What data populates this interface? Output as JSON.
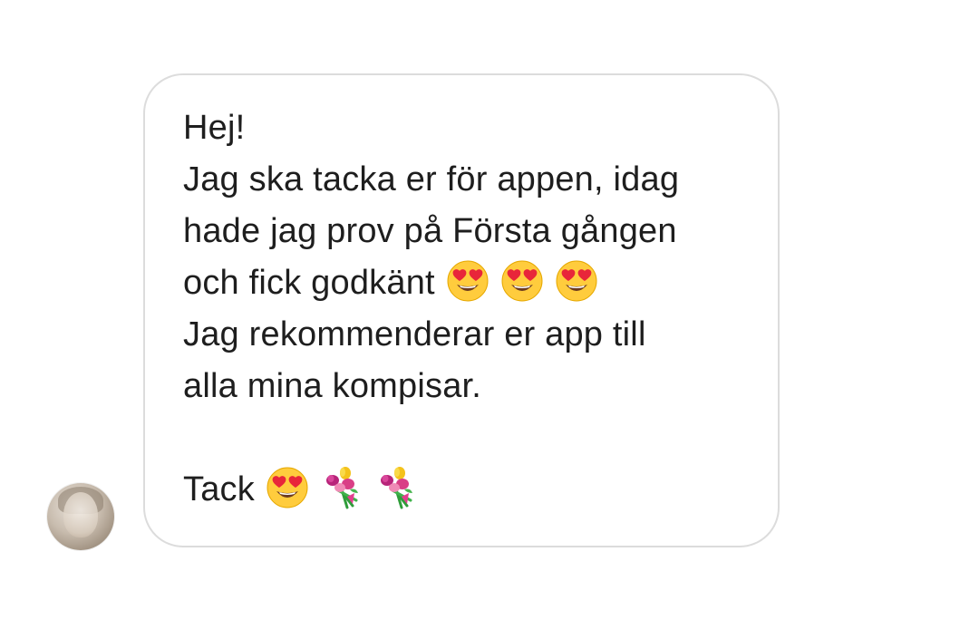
{
  "message": {
    "lines": [
      "Hej!",
      "Jag ska tacka er för appen, idag",
      "hade jag prov på Första gången",
      "och fick godkänt",
      "Jag rekommenderar er app till",
      "alla mina kompisar.",
      "Tack"
    ],
    "emojis": {
      "line4": [
        "heart-eyes-face",
        "heart-eyes-face",
        "heart-eyes-face"
      ],
      "line7": [
        "heart-eyes-face",
        "flower-bouquet",
        "flower-bouquet"
      ]
    }
  },
  "sender": {
    "avatar": "profile-photo"
  },
  "colors": {
    "bubble_border": "#dcdcdc",
    "text": "#1e1e1e",
    "background": "#ffffff"
  }
}
